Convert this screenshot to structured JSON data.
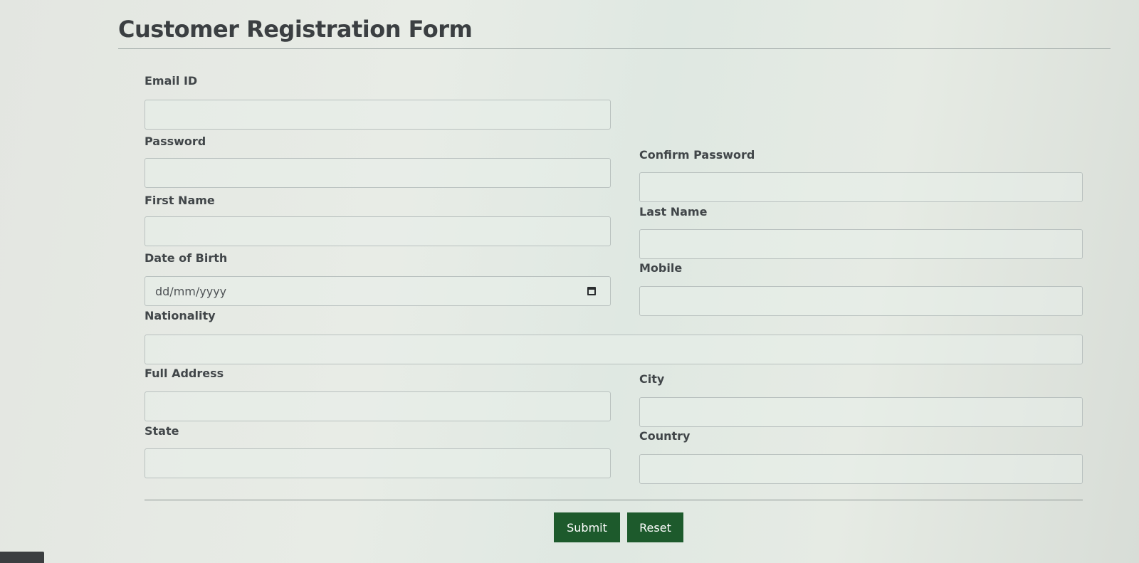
{
  "form": {
    "title": "Customer Registration Form",
    "fields": {
      "email": {
        "label": "Email ID",
        "value": ""
      },
      "password": {
        "label": "Password",
        "value": ""
      },
      "confirm_password": {
        "label": "Confirm Password",
        "value": ""
      },
      "first_name": {
        "label": "First Name",
        "value": ""
      },
      "last_name": {
        "label": "Last Name",
        "value": ""
      },
      "dob": {
        "label": "Date of Birth",
        "placeholder": "dd/mm/yyyy"
      },
      "mobile": {
        "label": "Mobile",
        "value": ""
      },
      "nationality": {
        "label": "Nationality",
        "value": ""
      },
      "full_address": {
        "label": "Full Address",
        "value": ""
      },
      "city": {
        "label": "City",
        "value": ""
      },
      "state": {
        "label": "State",
        "value": ""
      },
      "country": {
        "label": "Country",
        "value": ""
      }
    },
    "buttons": {
      "submit_label": "Submit",
      "reset_label": "Reset"
    }
  },
  "colors": {
    "button_bg": "#1d5a2c",
    "button_text": "#ffffff",
    "label_text": "#414649",
    "title_text": "#3b3f42"
  },
  "icons": {
    "date_picker": "calendar-icon"
  }
}
